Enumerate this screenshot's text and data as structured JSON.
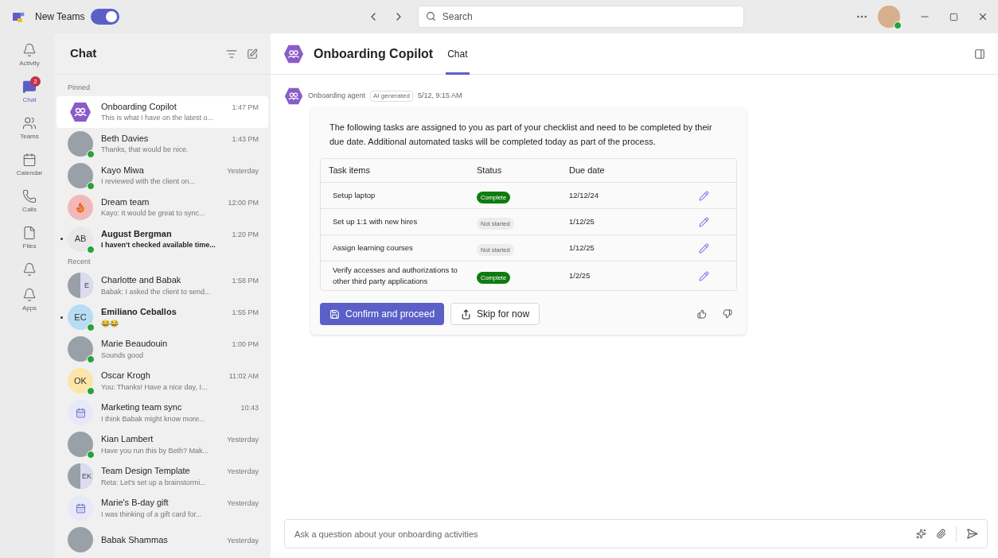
{
  "title_bar": {
    "app_name": "New Teams",
    "toggle_on": true,
    "search_placeholder": "Search",
    "online": true
  },
  "rail": [
    {
      "label": "Activity",
      "kind": "bell",
      "selected": false
    },
    {
      "label": "Chat",
      "kind": "chat",
      "selected": true,
      "badge": "2"
    },
    {
      "label": "Teams",
      "kind": "teams",
      "selected": false
    },
    {
      "label": "Calendar",
      "kind": "calendar",
      "selected": false
    },
    {
      "label": "Calls",
      "kind": "phone",
      "selected": false
    },
    {
      "label": "Files",
      "kind": "file",
      "selected": false
    },
    {
      "kind": "bell",
      "selected": false
    },
    {
      "label": "Apps",
      "kind": "bell",
      "selected": false
    }
  ],
  "chat_list": {
    "title": "Chat",
    "sections": [
      {
        "label": "Pinned",
        "items": [
          {
            "kind": "bot",
            "name": "Onboarding Copilot",
            "time": "1:47 PM",
            "preview": "This is what I have on the latest o...",
            "selected": true,
            "unread": false,
            "online": false
          },
          {
            "kind": "photo",
            "name": "Beth Davies",
            "time": "1:43 PM",
            "preview": "Thanks, that would be nice.",
            "selected": false,
            "unread": false,
            "online": true
          },
          {
            "kind": "photo",
            "name": "Kayo Miwa",
            "time": "Yesterday",
            "preview": "I reviewed with the client on...",
            "selected": false,
            "unread": false,
            "online": true
          },
          {
            "kind": "flame",
            "name": "Dream team",
            "time": "12:00 PM",
            "preview": "Kayo: It would be great to sync...",
            "selected": false,
            "unread": false,
            "online": false
          },
          {
            "kind": "initials",
            "initials": "AB",
            "color": "#e8e8e8",
            "name": "August Bergman",
            "time": "1:20 PM",
            "preview": "I haven't checked available time...",
            "selected": false,
            "unread": true,
            "online": true
          }
        ]
      },
      {
        "label": "Recent",
        "items": [
          {
            "kind": "group",
            "initials": "E",
            "name": "Charlotte and Babak",
            "time": "1:58 PM",
            "preview": "Babak: I asked the client to send...",
            "selected": false,
            "unread": false,
            "online": false
          },
          {
            "kind": "initials",
            "initials": "EC",
            "color": "#b7dcf3",
            "name": "Emiliano Ceballos",
            "time": "1:55 PM",
            "preview": "😂😂",
            "selected": false,
            "unread": true,
            "online": true
          },
          {
            "kind": "photo",
            "name": "Marie Beaudouin",
            "time": "1:00 PM",
            "preview": "Sounds good",
            "selected": false,
            "unread": false,
            "online": true
          },
          {
            "kind": "initials",
            "initials": "OK",
            "color": "#fbe6a8",
            "name": "Oscar Krogh",
            "time": "11:02 AM",
            "preview": "You: Thanks! Have a nice day, I...",
            "selected": false,
            "unread": false,
            "online": true
          },
          {
            "kind": "calendar",
            "name": "Marketing team sync",
            "time": "10:43",
            "preview": "I think Babak might know more...",
            "selected": false,
            "unread": false,
            "online": false
          },
          {
            "kind": "photo",
            "name": "Kian Lambert",
            "time": "Yesterday",
            "preview": "Have you run this by Beth? Mak...",
            "selected": false,
            "unread": false,
            "online": true
          },
          {
            "kind": "group",
            "initials": "EK",
            "name": "Team Design Template",
            "time": "Yesterday",
            "preview": "Reta: Let's set up a brainstormi...",
            "selected": false,
            "unread": false,
            "online": false
          },
          {
            "kind": "calendar",
            "name": "Marie's B-day gift",
            "time": "Yesterday",
            "preview": "I was thinking of a gift card for...",
            "selected": false,
            "unread": false,
            "online": false
          },
          {
            "kind": "photo",
            "name": "Babak Shammas",
            "time": "Yesterday",
            "selected": false,
            "unread": false,
            "online": false
          }
        ]
      }
    ]
  },
  "conversation": {
    "title": "Onboarding Copilot",
    "tabs": [
      {
        "label": "Chat",
        "selected": true
      }
    ],
    "message": {
      "sender": "Onboarding agent",
      "tag": "AI generated",
      "time": "5/12, 9:15 AM",
      "text": "The following tasks are assigned to you as part of your checklist and need to be completed by their due date. Additional automated tasks will be completed today as part of the process.",
      "table": {
        "columns": [
          "Task items",
          "Status",
          "Due date"
        ],
        "rows": [
          {
            "task": "Setup laptop",
            "status": {
              "kind": "complete",
              "label": "Complete"
            },
            "due": "12/12/24"
          },
          {
            "task": "Set up 1:1 with new hires",
            "status": {
              "kind": "not_started",
              "label": "Not started"
            },
            "due": "1/12/25"
          },
          {
            "task": "Assign learning courses",
            "status": {
              "kind": "not_started",
              "label": "Not started"
            },
            "due": "1/12/25"
          },
          {
            "task": "Verify accesses and authorizations to other third party applications",
            "status": {
              "kind": "complete",
              "label": "Complete"
            },
            "due": "1/2/25"
          }
        ]
      },
      "buttons": [
        {
          "kind": "primary",
          "label": "Confirm and proceed"
        },
        {
          "kind": "secondary",
          "label": "Skip for now"
        }
      ]
    },
    "composer": {
      "placeholder": "Ask a question about your onboarding activities"
    }
  }
}
